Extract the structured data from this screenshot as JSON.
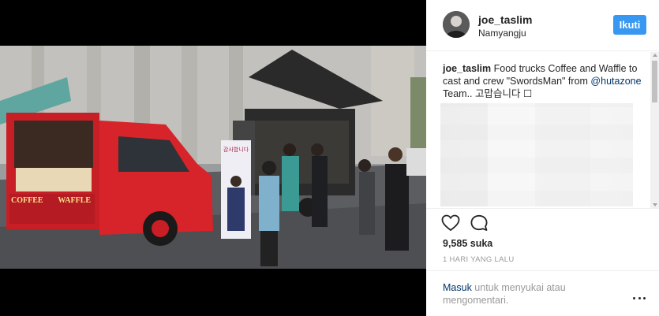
{
  "post": {
    "username": "joe_taslim",
    "location": "Namyangju",
    "follow_label": "Ikuti",
    "caption_username": "joe_taslim",
    "caption_text_1": " Food trucks Coffee and Waffle to cast and crew \"SwordsMan\" from ",
    "caption_mention": "@hutazone",
    "caption_text_2": " Team.. 고맙습니다 ☐",
    "likes": "9,585 suka",
    "time": "1 HARI YANG LALU",
    "login_link": "Masuk",
    "login_text": " untuk menyukai atau mengomentari."
  },
  "photo": {
    "truck_sign_1": "COFFEE",
    "truck_sign_2": "WAFFLE",
    "banner_text": "감사합니다"
  },
  "icons": {
    "like": "heart-icon",
    "comment": "comment-bubble-icon",
    "more": "more-options-icon",
    "user_tag": "user-tag-icon"
  },
  "colors": {
    "follow_button": "#3897f0",
    "link": "#003569",
    "truck_red": "#d7242b"
  }
}
